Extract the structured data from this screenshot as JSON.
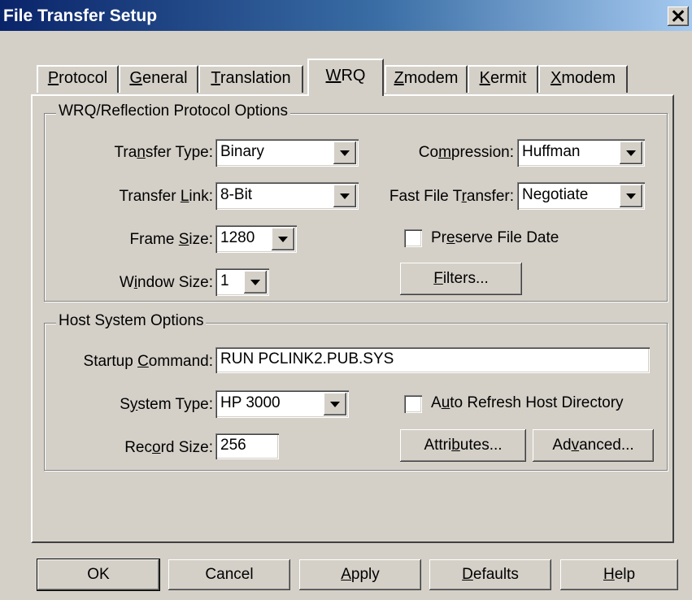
{
  "window": {
    "title": "File Transfer Setup",
    "close_glyph": "✕"
  },
  "tabs": [
    {
      "pre": "",
      "u": "P",
      "post": "rotocol"
    },
    {
      "pre": "",
      "u": "G",
      "post": "eneral"
    },
    {
      "pre": "",
      "u": "T",
      "post": "ranslation"
    },
    {
      "pre": "",
      "u": "W",
      "post": "RQ"
    },
    {
      "pre": "",
      "u": "Z",
      "post": "modem"
    },
    {
      "pre": "",
      "u": "K",
      "post": "ermit"
    },
    {
      "pre": "",
      "u": "X",
      "post": "modem"
    }
  ],
  "wrq_group": {
    "title": "WRQ/Reflection Protocol Options",
    "transfer_type": {
      "pre": "Tra",
      "u": "n",
      "post": "sfer Type:",
      "value": "Binary"
    },
    "transfer_link": {
      "pre": "Transfer ",
      "u": "L",
      "post": "ink:",
      "value": "8-Bit"
    },
    "frame_size": {
      "pre": "Frame ",
      "u": "S",
      "post": "ize:",
      "value": "1280"
    },
    "window_size": {
      "pre": "W",
      "u": "i",
      "post": "ndow Size:",
      "value": "1"
    },
    "compression": {
      "pre": "Co",
      "u": "m",
      "post": "pression:",
      "value": "Huffman"
    },
    "fast_file_transfer": {
      "pre": "Fast File T",
      "u": "r",
      "post": "ansfer:",
      "value": "Negotiate"
    },
    "preserve_file_date": {
      "pre": "Pr",
      "u": "e",
      "post": "serve File Date"
    },
    "filters_button": {
      "pre": "",
      "u": "F",
      "post": "ilters..."
    }
  },
  "host_group": {
    "title": "Host System Options",
    "startup_command": {
      "pre": "Startup ",
      "u": "C",
      "post": "ommand:",
      "value": "RUN PCLINK2.PUB.SYS"
    },
    "system_type": {
      "pre": "S",
      "u": "y",
      "post": "stem Type:",
      "value": "HP 3000"
    },
    "record_size": {
      "pre": "Rec",
      "u": "o",
      "post": "rd Size:",
      "value": "256"
    },
    "auto_refresh": {
      "pre": "A",
      "u": "u",
      "post": "to Refresh Host Directory"
    },
    "attributes_button": {
      "pre": "Attri",
      "u": "b",
      "post": "utes..."
    },
    "advanced_button": {
      "pre": "Ad",
      "u": "v",
      "post": "anced..."
    }
  },
  "buttons": {
    "ok": "OK",
    "cancel": "Cancel",
    "apply": {
      "pre": "",
      "u": "A",
      "post": "pply"
    },
    "defaults": {
      "pre": "",
      "u": "D",
      "post": "efaults"
    },
    "help": {
      "pre": "",
      "u": "H",
      "post": "elp"
    }
  }
}
